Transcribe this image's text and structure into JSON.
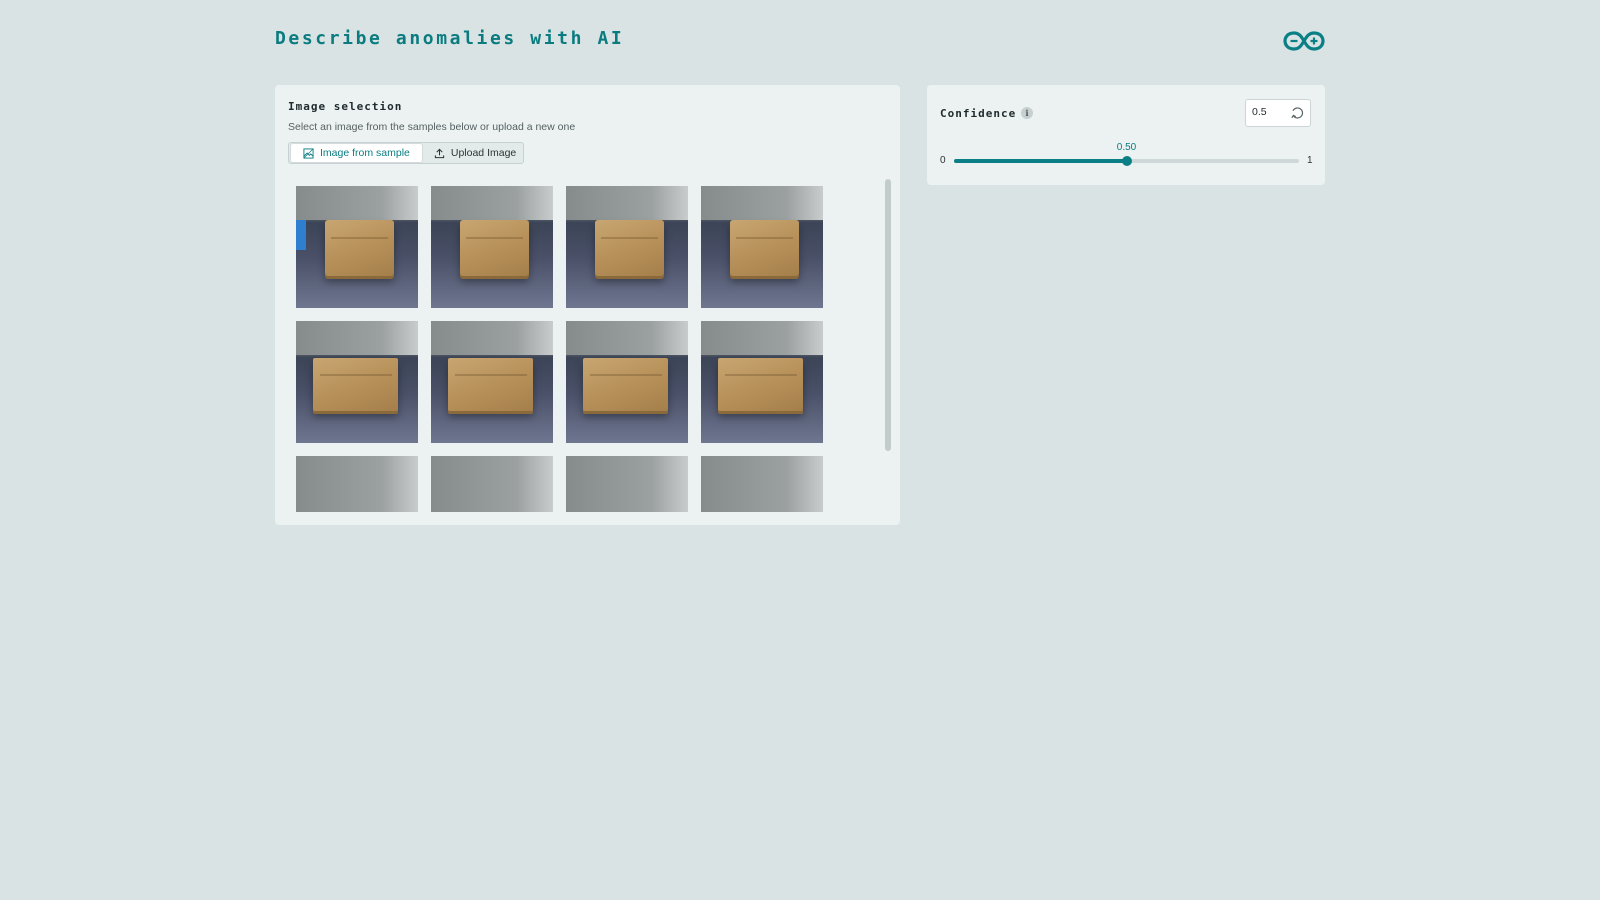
{
  "header": {
    "title": "Describe anomalies with AI",
    "logo_icon": "arduino-logo-icon",
    "accent_color": "#0a7c80"
  },
  "image_selection": {
    "title": "Image selection",
    "subtitle": "Select an image from the samples below or upload a new one",
    "tabs": [
      {
        "label": "Image from sample",
        "icon": "image-icon",
        "active": true
      },
      {
        "label": "Upload Image",
        "icon": "upload-icon",
        "active": false
      }
    ],
    "samples_count_visible": 12
  },
  "confidence": {
    "label": "Confidence",
    "info_icon": "info-icon",
    "input_value": "0.5",
    "slider": {
      "min": "0",
      "max": "1",
      "value": 0.5,
      "value_label": "0.50"
    },
    "reset_icon": "reset-icon"
  }
}
